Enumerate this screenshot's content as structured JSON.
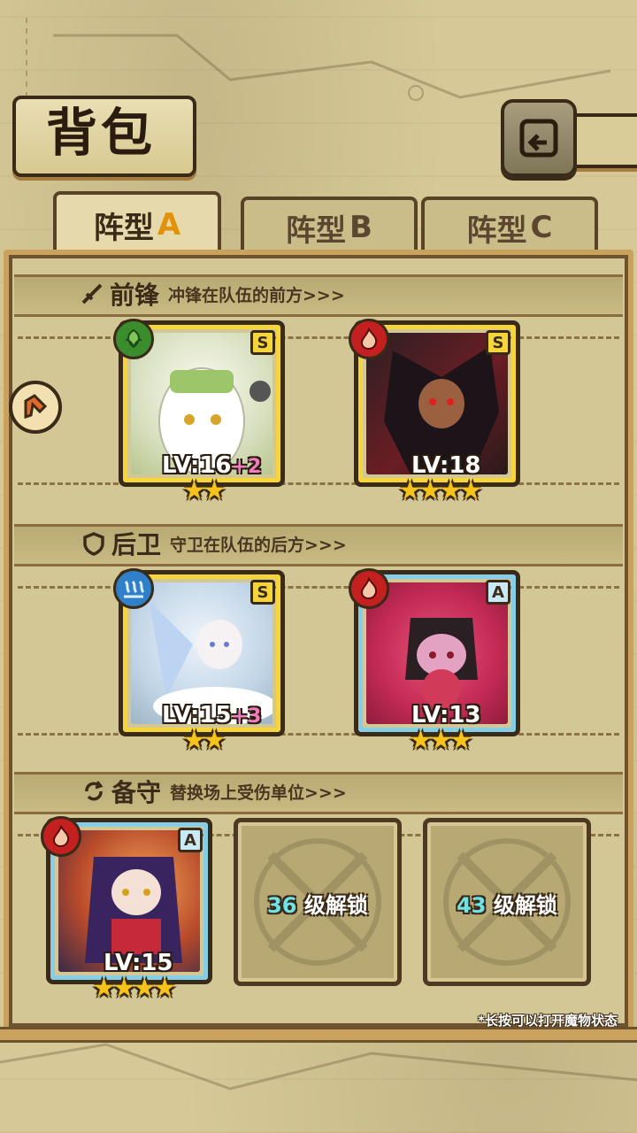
{
  "header": {
    "title": "背包"
  },
  "tabs": [
    {
      "label": "阵型",
      "suffix": "A",
      "active": true
    },
    {
      "label": "阵型",
      "suffix": "B",
      "active": false
    },
    {
      "label": "阵型",
      "suffix": "C",
      "active": false
    }
  ],
  "sections": {
    "front": {
      "name": "前锋",
      "desc": "冲锋在队伍的前方>>>",
      "icon": "sword-icon"
    },
    "rear": {
      "name": "后卫",
      "desc": "守卫在队伍的后方>>>",
      "icon": "shield-icon"
    },
    "reserve": {
      "name": "备守",
      "desc": "替换场上受伤单位>>>",
      "icon": "swap-icon"
    }
  },
  "cards": [
    {
      "rank": "S",
      "element": "leaf",
      "level": "LV:16",
      "bonus": "+2",
      "stars": 2,
      "frame": "gold"
    },
    {
      "rank": "S",
      "element": "fire",
      "level": "LV:18",
      "bonus": "",
      "stars": 4,
      "frame": "gold"
    },
    {
      "rank": "S",
      "element": "water",
      "level": "LV:15",
      "bonus": "+3",
      "stars": 2,
      "frame": "gold"
    },
    {
      "rank": "A",
      "element": "fire",
      "level": "LV:13",
      "bonus": "",
      "stars": 3,
      "frame": "blue"
    },
    {
      "rank": "A",
      "element": "fire",
      "level": "LV:15",
      "bonus": "",
      "stars": 4,
      "frame": "blue"
    }
  ],
  "locked_slots": [
    {
      "level": "36",
      "label": "级解锁"
    },
    {
      "level": "43",
      "label": "级解锁"
    }
  ],
  "footer": {
    "hint": "*长按可以打开魔物状态"
  },
  "colors": {
    "gold_frame": "#f5d53a",
    "blue_frame": "#86cde6",
    "fire": "#c52020",
    "leaf": "#3a8c2c",
    "water": "#2f7fc9",
    "accent_tab": "#e1920a"
  }
}
